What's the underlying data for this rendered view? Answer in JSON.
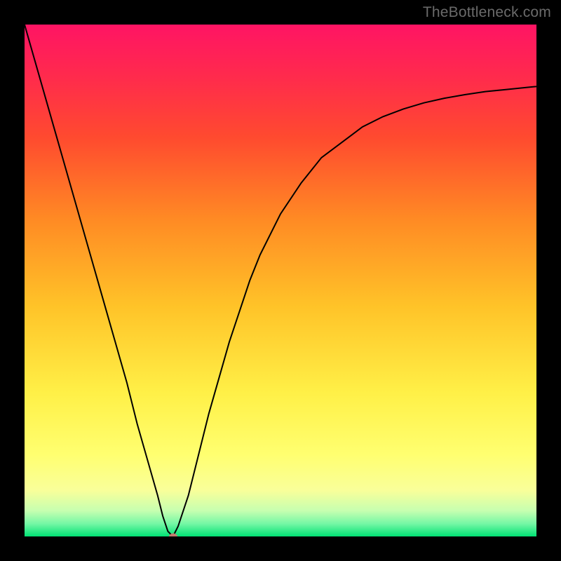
{
  "watermark": "TheBottleneck.com",
  "chart_data": {
    "type": "line",
    "title": "",
    "xlabel": "",
    "ylabel": "",
    "xlim": [
      0,
      100
    ],
    "ylim": [
      0,
      100
    ],
    "x": [
      0,
      2,
      4,
      6,
      8,
      10,
      12,
      14,
      16,
      18,
      20,
      22,
      24,
      26,
      27,
      28,
      29,
      30,
      32,
      34,
      36,
      38,
      40,
      42,
      44,
      46,
      48,
      50,
      54,
      58,
      62,
      66,
      70,
      74,
      78,
      82,
      86,
      90,
      94,
      98,
      100
    ],
    "values": [
      100,
      93,
      86,
      79,
      72,
      65,
      58,
      51,
      44,
      37,
      30,
      22,
      15,
      8,
      4,
      1,
      0,
      2,
      8,
      16,
      24,
      31,
      38,
      44,
      50,
      55,
      59,
      63,
      69,
      74,
      77,
      80,
      82,
      83.5,
      84.7,
      85.6,
      86.3,
      86.9,
      87.3,
      87.7,
      87.9
    ],
    "minimum_point": {
      "x": 29,
      "y": 0
    },
    "gradient_stops": [
      {
        "pct": 0,
        "color": "#ff1464"
      },
      {
        "pct": 10,
        "color": "#ff2a4d"
      },
      {
        "pct": 22,
        "color": "#ff4a2f"
      },
      {
        "pct": 38,
        "color": "#ff8a24"
      },
      {
        "pct": 55,
        "color": "#ffc328"
      },
      {
        "pct": 72,
        "color": "#fff047"
      },
      {
        "pct": 84,
        "color": "#ffff70"
      },
      {
        "pct": 91,
        "color": "#f9ff9a"
      },
      {
        "pct": 95,
        "color": "#c6ffb0"
      },
      {
        "pct": 97.5,
        "color": "#75f7a5"
      },
      {
        "pct": 100,
        "color": "#00e274"
      }
    ]
  }
}
